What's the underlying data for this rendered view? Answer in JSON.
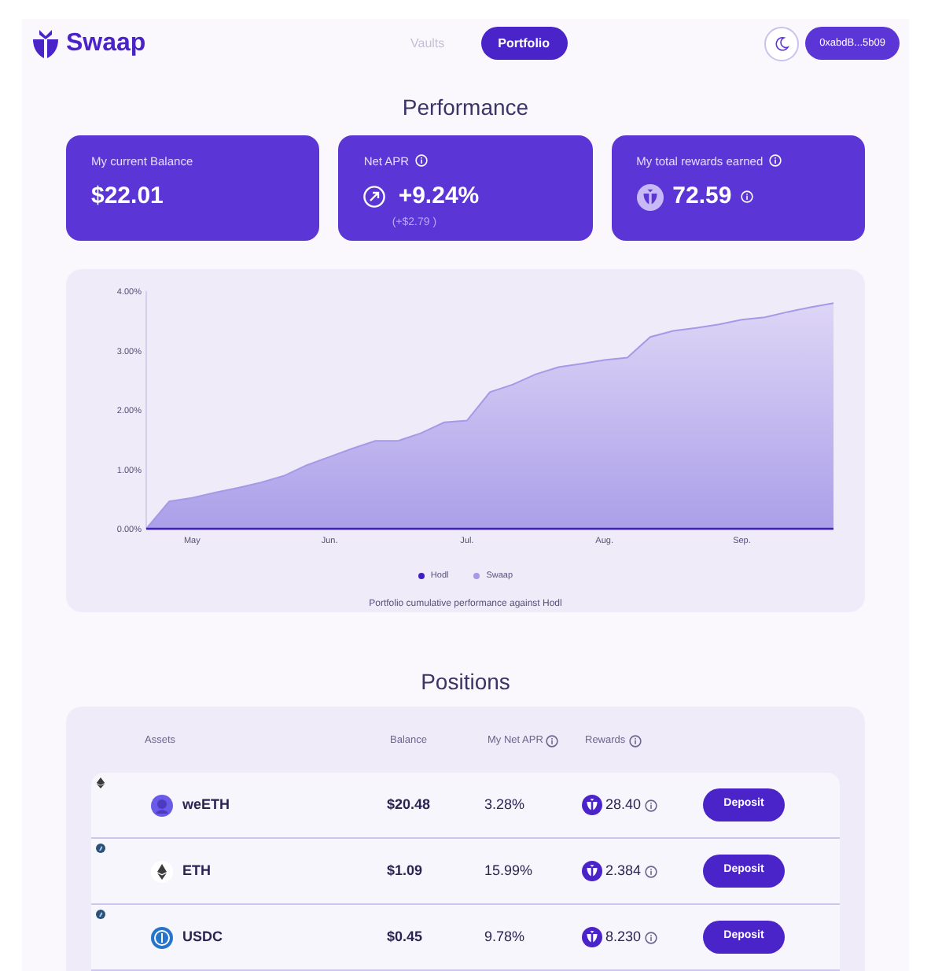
{
  "header": {
    "logo": "Swaap",
    "nav": [
      {
        "label": "Vaults",
        "selected": false
      },
      {
        "label": "Portfolio",
        "selected": true
      }
    ],
    "wallet": "0xabdB...5b09"
  },
  "performance": {
    "title": "Performance",
    "cards": [
      {
        "kind": "balance",
        "label": "My current Balance",
        "value": "$22.01"
      },
      {
        "kind": "apr",
        "label": "Net APR",
        "value": "+9.24%",
        "sub": "(+$2.79 )"
      },
      {
        "kind": "rewards",
        "label": "My total rewards earned",
        "value": "72.59"
      }
    ],
    "chart_data": {
      "type": "area",
      "categories": [
        null,
        null,
        "May",
        null,
        null,
        null,
        null,
        null,
        "Jun.",
        null,
        null,
        null,
        null,
        null,
        "Jul.",
        null,
        null,
        null,
        null,
        null,
        "Aug.",
        null,
        null,
        null,
        null,
        null,
        "Sep.",
        null,
        null,
        null,
        null
      ],
      "yticks": [
        {
          "value": 0,
          "label": "0.00%"
        },
        {
          "value": 1,
          "label": "1.00%"
        },
        {
          "value": 2,
          "label": "2.00%"
        },
        {
          "value": 3,
          "label": "3.00%"
        },
        {
          "value": 4,
          "label": "4.00%"
        }
      ],
      "ylim": [
        0,
        4
      ],
      "series": [
        {
          "name": "Swaap",
          "color": "#a59ae8",
          "values": [
            0,
            0.46,
            0.52,
            0.61,
            0.69,
            0.78,
            0.89,
            1.07,
            1.21,
            1.35,
            1.48,
            1.48,
            1.61,
            1.79,
            1.82,
            2.3,
            2.43,
            2.6,
            2.72,
            2.78,
            2.84,
            2.88,
            3.23,
            3.33,
            3.38,
            3.44,
            3.52,
            3.56,
            3.65,
            3.73,
            3.8
          ]
        }
      ]
    },
    "baseline": {
      "name": "Hodl",
      "color": "#3d1fc0"
    },
    "caption": "Portfolio cumulative performance against Hodl"
  },
  "positions": {
    "title": "Positions",
    "columns": [
      "Assets",
      "Balance",
      "My Net APR",
      "Rewards"
    ],
    "rows": [
      {
        "kind": "weeth",
        "asset": "weETH",
        "balance": "$20.48",
        "apr": "3.28%",
        "rewards": "28.40",
        "action": "Deposit"
      },
      {
        "kind": "eth",
        "asset": "ETH",
        "balance": "$1.09",
        "apr": "15.99%",
        "rewards": "2.384",
        "action": "Deposit"
      },
      {
        "kind": "usdc",
        "asset": "USDC",
        "balance": "$0.45",
        "apr": "9.78%",
        "rewards": "8.230",
        "action": "Deposit"
      }
    ]
  }
}
